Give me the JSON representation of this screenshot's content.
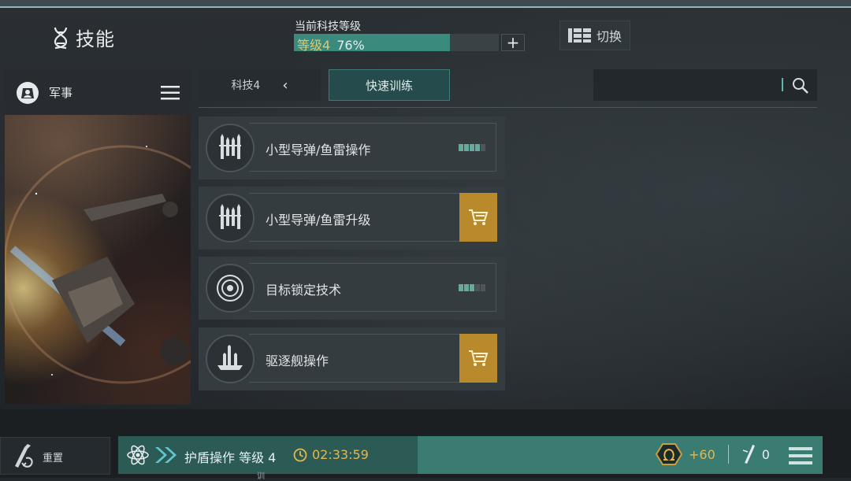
{
  "header": {
    "title": "技能",
    "tech_label": "当前科技等级",
    "tech_level": "等级4",
    "tech_percent": "76%",
    "tech_progress": 0.76,
    "plus": "+",
    "switch_label": "切换"
  },
  "left_panel": {
    "category": "军事"
  },
  "tabs": {
    "tech_tab": "科技4",
    "quick_train": "快速训练"
  },
  "skills": [
    {
      "name": "小型导弹/鱼雷操作",
      "icon": "missile-icon",
      "level": 4,
      "max_level": 5,
      "action": "level"
    },
    {
      "name": "小型导弹/鱼雷升级",
      "icon": "missile-icon",
      "action": "buy"
    },
    {
      "name": "目标锁定技术",
      "icon": "target-icon",
      "level": 3,
      "max_level": 5,
      "action": "level"
    },
    {
      "name": "驱逐舰操作",
      "icon": "destroyer-icon",
      "action": "buy"
    }
  ],
  "bottom": {
    "reset_label": "重置",
    "queue_skill": "护盾操作 等级 4",
    "queue_time": "02:33:59",
    "bonus": "+60",
    "injector_count": "0",
    "under_text": "训"
  },
  "colors": {
    "accent_teal": "#3a8a7e",
    "gold": "#b88a2c",
    "level_on": "#66a99d"
  }
}
